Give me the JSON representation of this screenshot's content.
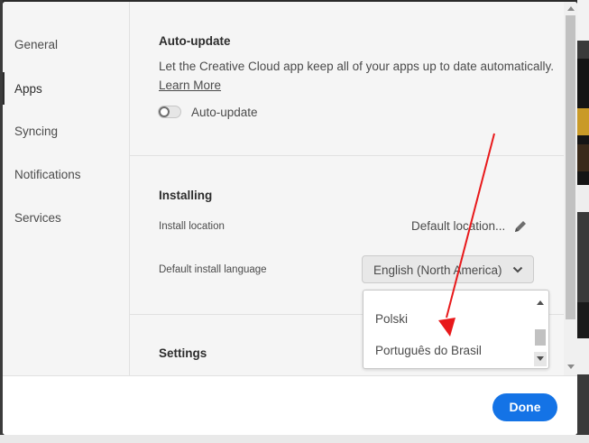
{
  "sidebar": {
    "items": [
      {
        "label": "General"
      },
      {
        "label": "Apps"
      },
      {
        "label": "Syncing"
      },
      {
        "label": "Notifications"
      },
      {
        "label": "Services"
      }
    ],
    "active": "Apps"
  },
  "auto_update": {
    "title": "Auto-update",
    "description": "Let the Creative Cloud app keep all of your apps up to date automatically.",
    "learn_more": "Learn More",
    "toggle_label": "Auto-update",
    "toggle_on": false
  },
  "installing": {
    "title": "Installing",
    "install_location_label": "Install location",
    "install_location_value": "Default location...",
    "language_label": "Default install language",
    "language_value": "English (North America)",
    "language_options_visible": [
      "Polski",
      "Português do Brasil"
    ]
  },
  "settings": {
    "title": "Settings"
  },
  "footer": {
    "done_label": "Done"
  },
  "colors": {
    "accent": "#1473e6",
    "annotation_arrow": "#e8191b",
    "panel_background": "#f5f5f5"
  },
  "icons": {
    "edit": "pencil-icon",
    "dropdown": "chevron-down-icon",
    "scroll_up": "triangle-up-icon",
    "scroll_down": "triangle-down-icon"
  }
}
